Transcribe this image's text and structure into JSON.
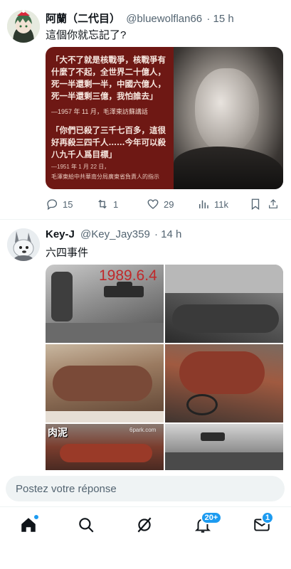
{
  "tweets": [
    {
      "display_name": "阿蘭（二代目）",
      "handle": "@bluewolflan66",
      "time": "· 15 h",
      "text": "這個你就忘記了?",
      "media": {
        "quote1": "「大不了就是核戰爭，核戰爭有什麼了不起，全世界二十億人，死一半還剩一半，中國六億人，死一半還剩三億，我怕誰去」",
        "source1": "—1957 年 11 月，毛澤東訪蘇講話",
        "quote2": "「你們已殺了三千七百多，這很好再殺三四千人……今年可以殺八九千人爲目標」",
        "source2": "—1951 年 1 月 22 日，",
        "source2b": "毛澤東給中共華南分局廣東省負責人的指示"
      },
      "actions": {
        "replies": "15",
        "retweets": "1",
        "likes": "29",
        "views": "11k"
      }
    },
    {
      "display_name": "Key-J",
      "handle": "@Key_Jay359",
      "time": "· 14 h",
      "text": "六四事件",
      "media": {
        "date_stamp": "1989.6.4",
        "caption_meat": "肉泥",
        "watermark": "6park.com"
      }
    }
  ],
  "reply_placeholder": "Postez votre réponse",
  "nav": {
    "notifications_badge": "20+",
    "messages_badge": "1",
    "accent": "#1d9bf0"
  }
}
